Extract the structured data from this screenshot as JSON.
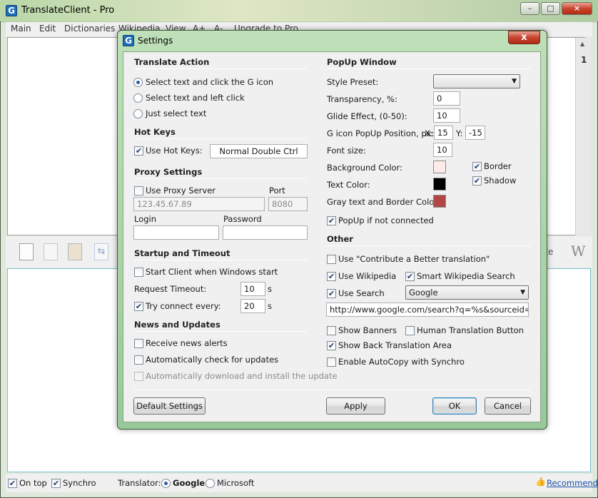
{
  "app": {
    "title": "TranslateClient - Pro",
    "icon_letter": "G",
    "menu": [
      "Main",
      "Edit",
      "Dictionaries",
      "Wikipedia",
      "View",
      "A+",
      "A-",
      "Upgrade to Pro"
    ],
    "page_number": "1",
    "toolbar_right_text": "ate",
    "status": {
      "on_top_label": "On top",
      "synchro_label": "Synchro",
      "translator_label": "Translator:",
      "google_label": "Google",
      "microsoft_label": "Microsoft",
      "recommend_label": "Recommend"
    }
  },
  "dialog": {
    "title": "Settings",
    "close": "x",
    "translate_action": {
      "header": "Translate Action",
      "options": [
        "Select text and click the G icon",
        "Select text and left click",
        "Just select text"
      ],
      "selected_index": 0
    },
    "hot_keys": {
      "header": "Hot Keys",
      "use_label": "Use Hot Keys:",
      "value": "Normal Double Ctrl"
    },
    "proxy": {
      "header": "Proxy Settings",
      "use_label": "Use Proxy Server",
      "port_label": "Port",
      "server_placeholder": "123.45.67.89",
      "port_placeholder": "8080",
      "login_label": "Login",
      "password_label": "Password"
    },
    "startup": {
      "header": "Startup and Timeout",
      "start_label": "Start Client when Windows start",
      "timeout_label": "Request Timeout:",
      "timeout_value": "10",
      "try_label": "Try connect every:",
      "try_value": "20",
      "unit": "s"
    },
    "news": {
      "header": "News and Updates",
      "receive_label": "Receive news alerts",
      "autocheck_label": "Automatically check for updates",
      "autodownload_label": "Automatically download and install the update"
    },
    "popup": {
      "header": "PopUp Window",
      "style_label": "Style Preset:",
      "style_value": "",
      "transparency_label": "Transparency, %:",
      "transparency_value": "0",
      "glide_label": "Glide Effect, (0-50):",
      "glide_value": "10",
      "position_label": "G icon PopUp Position, px:",
      "x_label": "X:",
      "x_value": "15",
      "y_label": "Y:",
      "y_value": "-15",
      "font_label": "Font size:",
      "font_value": "10",
      "bg_label": "Background Color:",
      "text_color_label": "Text Color:",
      "gray_label": "Gray text and Border Color:",
      "border_label": "Border",
      "shadow_label": "Shadow",
      "not_connected_label": "PopUp if not connected",
      "colors": {
        "background": "#fcebe6",
        "text": "#000000",
        "gray": "#b04646"
      }
    },
    "other": {
      "header": "Other",
      "contribute_label": "Use \"Contribute a Better translation\"",
      "wikipedia_label": "Use Wikipedia",
      "smart_wiki_label": "Smart Wikipedia Search",
      "search_label": "Use Search",
      "search_engine": "Google",
      "search_url": "http://www.google.com/search?q=%s&sourceid=%tc&ie",
      "banners_label": "Show Banners",
      "human_label": "Human Translation Button",
      "back_label": "Show Back Translation Area",
      "autocopy_label": "Enable AutoCopy with Synchro"
    },
    "buttons": {
      "default_settings": "Default Settings",
      "apply": "Apply",
      "ok": "OK",
      "cancel": "Cancel"
    }
  }
}
